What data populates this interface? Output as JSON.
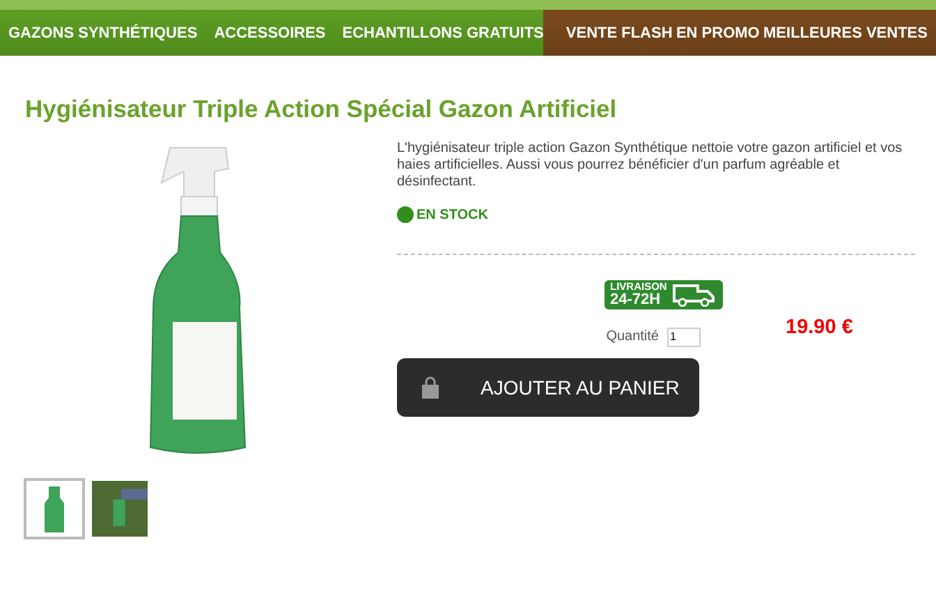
{
  "nav": {
    "primary": [
      {
        "label": "GAZONS SYNTHÉTIQUES"
      },
      {
        "label": "ACCESSOIRES"
      },
      {
        "label": "ECHANTILLONS GRATUITS"
      }
    ],
    "secondary": [
      {
        "label": "VENTE FLASH"
      },
      {
        "label": "EN PROMO"
      },
      {
        "label": "MEILLEURES VENTES"
      }
    ]
  },
  "product": {
    "title": "Hygiénisateur Triple Action Spécial Gazon Artificiel",
    "description": "L'hygiénisateur triple action Gazon Synthétique nettoie votre gazon artificiel et vos haies artificielles. Aussi vous pourrez bénéficier d'un parfum agréable et désinfectant.",
    "stock": {
      "label": "EN STOCK",
      "in_stock": true
    },
    "delivery_badge": {
      "line_1": "LIVRAISON",
      "line_2": "24-72H"
    },
    "quantity": {
      "label": "Quantité",
      "value": "1"
    },
    "price": "19.90 €",
    "add_to_cart": "AJOUTER AU PANIER",
    "thumbnails": [
      {
        "kind": "bottle",
        "selected": true
      },
      {
        "kind": "spraying",
        "selected": false
      }
    ]
  }
}
